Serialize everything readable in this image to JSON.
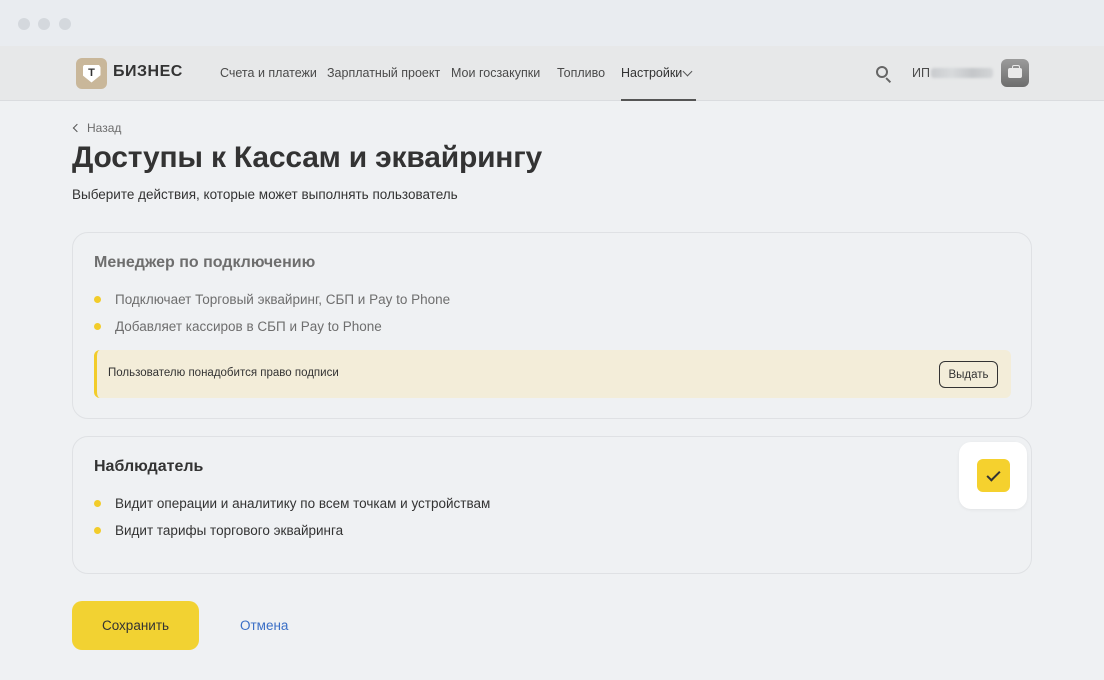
{
  "header": {
    "logo_letter": "T",
    "logo_text": "БИЗНЕС",
    "nav": [
      {
        "label": "Счета и платежи"
      },
      {
        "label": "Зарплатный проект"
      },
      {
        "label": "Мои госзакупки"
      },
      {
        "label": "Топливо"
      },
      {
        "label": "Настройки",
        "active": true
      }
    ],
    "org_prefix": "ИП",
    "icons": [
      "search-icon",
      "chevron-down-icon",
      "briefcase-icon"
    ]
  },
  "page": {
    "back_label": "Назад",
    "title": "Доступы к Кассам и эквайрингу",
    "subtitle": "Выберите действия, которые может выполнять пользователь"
  },
  "roles": [
    {
      "title": "Менеджер по подключению",
      "items": [
        "Подключает Торговый эквайринг, СБП и Pay to Phone",
        "Добавляет кассиров в СБП и Pay to Phone"
      ],
      "notice": "Пользователю понадобится право подписи",
      "notice_action": "Выдать",
      "enabled": false
    },
    {
      "title": "Наблюдатель",
      "items": [
        "Видит операции и аналитику по всем точкам и устройствам",
        "Видит тарифы торгового эквайринга"
      ],
      "checked": true
    }
  ],
  "actions": {
    "save_label": "Сохранить",
    "cancel_label": "Отмена"
  },
  "colors": {
    "accent": "#f2d232",
    "link": "#3b6fc6",
    "notice_bg": "#f3edd9",
    "background": "#eff1f3"
  }
}
